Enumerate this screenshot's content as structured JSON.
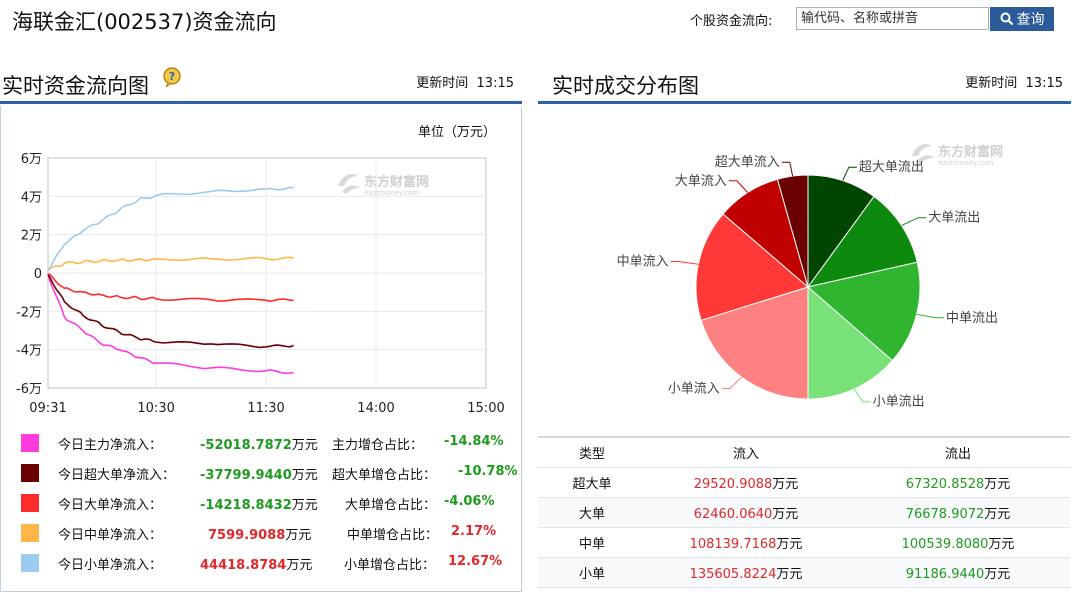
{
  "header": {
    "title": "海联金汇(002537)资金流向",
    "search_label": "个股资金流向:",
    "search_placeholder": "输代码、名称或拼音",
    "search_button": "查询"
  },
  "left_section": {
    "title": "实时资金流向图",
    "update_label": "更新时间",
    "update_time": "13:15",
    "unit_label": "单位（万元）"
  },
  "right_section": {
    "title": "实时成交分布图",
    "update_label": "更新时间",
    "update_time": "13:15"
  },
  "watermark": {
    "cn": "东方财富网",
    "en": "eastmoney.com"
  },
  "legend": {
    "unit": "万元",
    "items": [
      {
        "name": "今日主力净流入：",
        "value": "-52018.7872",
        "ratio_label": "主力增仓占比：",
        "ratio": "-14.84%",
        "color": "#ff3cde",
        "dir": "neg"
      },
      {
        "name": "今日超大单净流入：",
        "value": "-37799.9440",
        "ratio_label": "超大单增仓占比：",
        "ratio": "-10.78%",
        "color": "#6b0000",
        "dir": "neg"
      },
      {
        "name": "今日大单净流入：",
        "value": "-14218.8432",
        "ratio_label": "大单增仓占比：",
        "ratio": "-4.06%",
        "color": "#ff2a2a",
        "dir": "neg"
      },
      {
        "name": "今日中单净流入：",
        "value": "7599.9088",
        "ratio_label": "中单增仓占比：",
        "ratio": "2.17%",
        "color": "#ffb74a",
        "dir": "pos"
      },
      {
        "name": "今日小单净流入：",
        "value": "44418.8784",
        "ratio_label": "小单增仓占比：",
        "ratio": "12.67%",
        "color": "#9ccbf0",
        "dir": "pos"
      }
    ]
  },
  "table": {
    "headers": [
      "类型",
      "流入",
      "流出"
    ],
    "unit": "万元",
    "rows": [
      {
        "type": "超大单",
        "in": "29520.9088",
        "out": "67320.8528"
      },
      {
        "type": "大单",
        "in": "62460.0640",
        "out": "76678.9072"
      },
      {
        "type": "中单",
        "in": "108139.7168",
        "out": "100539.8080"
      },
      {
        "type": "小单",
        "in": "135605.8224",
        "out": "91186.9440"
      }
    ]
  },
  "colors": {
    "accent": "#2a63ab",
    "positive": "#e0282d",
    "negative": "#1e9b1e"
  },
  "chart_data": [
    {
      "type": "line",
      "title": "实时资金流向图",
      "ylabel": "单位（万元）",
      "x_ticks": [
        "09:31",
        "10:30",
        "11:30",
        "14:00",
        "15:00"
      ],
      "y_ticks": [
        "6万",
        "4万",
        "2万",
        "0",
        "-2万",
        "-4万",
        "-6万"
      ],
      "ylim": [
        -60000,
        60000
      ],
      "x_time_range": [
        "09:31",
        "15:00"
      ],
      "grid": true,
      "x": [
        "09:31",
        "09:40",
        "09:50",
        "10:00",
        "10:10",
        "10:20",
        "10:30",
        "11:00",
        "11:30",
        "13:15"
      ],
      "series": [
        {
          "color": "#ff3cde",
          "values": [
            -1000,
            -23000,
            -30000,
            -37000,
            -40000,
            -44000,
            -47000,
            -49500,
            -51000,
            -52000
          ]
        },
        {
          "color": "#6b0000",
          "values": [
            -800,
            -15000,
            -22000,
            -27000,
            -31000,
            -34000,
            -36000,
            -37000,
            -38500,
            -37800
          ]
        },
        {
          "color": "#ff2a2a",
          "values": [
            -500,
            -8000,
            -10000,
            -11500,
            -12500,
            -13000,
            -13500,
            -14000,
            -14200,
            -14200
          ]
        },
        {
          "color": "#ffb74a",
          "values": [
            1500,
            5000,
            5800,
            6400,
            6800,
            7000,
            7200,
            7400,
            7500,
            7600
          ]
        },
        {
          "color": "#9ccbf0",
          "values": [
            1500,
            15000,
            22000,
            27000,
            33000,
            38000,
            40500,
            42500,
            43800,
            44400
          ]
        }
      ]
    },
    {
      "type": "pie",
      "title": "实时成交分布图",
      "categories": [
        "超大单流出",
        "大单流出",
        "中单流出",
        "小单流出",
        "小单流入",
        "中单流入",
        "大单流入",
        "超大单流入"
      ],
      "values": [
        67320.8528,
        76678.9072,
        100539.808,
        91186.944,
        135605.8224,
        108139.7168,
        62460.064,
        29520.9088
      ],
      "colors": [
        "#004500",
        "#0d8a0d",
        "#2fb52f",
        "#78e278",
        "#ff8080",
        "#ff3838",
        "#c10000",
        "#6b0000"
      ]
    }
  ]
}
